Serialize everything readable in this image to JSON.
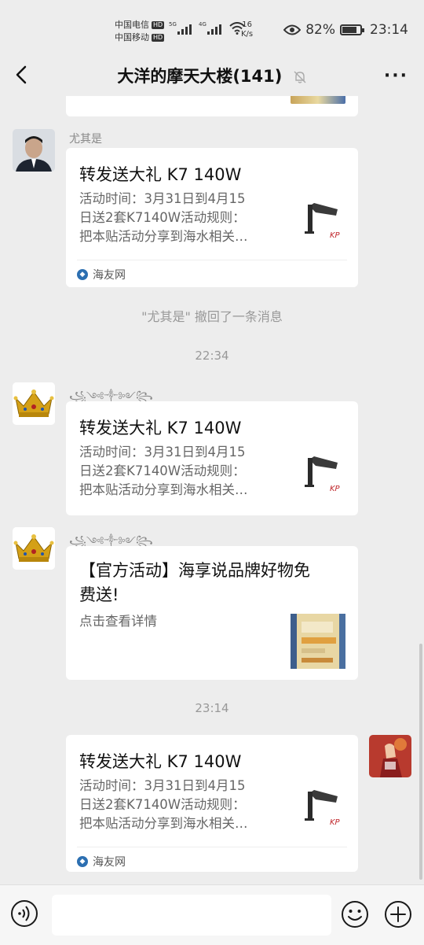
{
  "status": {
    "carrier1": "中国电信",
    "carrier2": "中国移动",
    "hd": "HD",
    "net1": "5G",
    "net2": "4G",
    "speed_value": "16",
    "speed_unit": "K/s",
    "battery": "82%",
    "battery_level": 0.82,
    "time": "23:14"
  },
  "header": {
    "title": "大洋的摩天大楼(141)",
    "more": "···"
  },
  "messages": {
    "m1": {
      "nickname": "尤其是",
      "title": "转发送大礼 K7 140W",
      "line1": "活动时间：3月31日到4月15",
      "line2": "日送2套K7140W活动规则：",
      "line3": "把本贴活动分享到海水相关…",
      "source": "海友网"
    },
    "recall": "\"尤其是\" 撤回了一条消息",
    "time1": "22:34",
    "m2": {
      "nickname": "꧁༺༒༻꧂",
      "title": "转发送大礼 K7 140W",
      "line1": "活动时间：3月31日到4月15",
      "line2": "日送2套K7140W活动规则：",
      "line3": "把本贴活动分享到海水相关…"
    },
    "m3": {
      "nickname": "꧁༺༒༻꧂",
      "title1": "【官方活动】海享说品牌好物免",
      "title2": "费送!",
      "desc": "点击查看详情"
    },
    "time2": "23:14",
    "m4": {
      "title": "转发送大礼 K7 140W",
      "line1": "活动时间：3月31日到4月15",
      "line2": "日送2套K7140W活动规则：",
      "line3": "把本贴活动分享到海水相关…",
      "source": "海友网"
    }
  },
  "colors": {
    "background": "#ededed",
    "card": "#ffffff",
    "muted": "#999999"
  }
}
